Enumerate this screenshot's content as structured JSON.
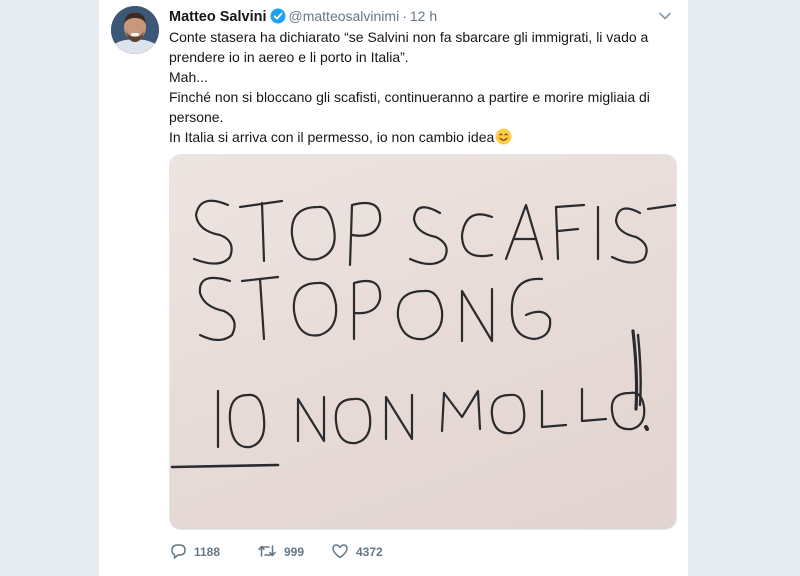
{
  "tweet": {
    "author_name": "Matteo Salvini",
    "handle": "@matteosalvinimi",
    "separator": "·",
    "timestamp": "12 h",
    "lines": [
      "Conte stasera ha dichiarato “se Salvini non fa sbarcare gli immigrati, li vado a prendere io in aereo e li porto in Italia”.",
      "Mah...",
      "Finché non si bloccano gli scafisti, continueranno a partire e morire migliaia di persone.",
      "In Italia si arriva con il permesso, io non cambio idea"
    ],
    "trailing_emoji": "smiling-face-emoji",
    "image_text": [
      "STOP SCAFISTI",
      "STOP ONG",
      "IO NON MOLLO!"
    ]
  },
  "actions": {
    "reply_count": "1188",
    "retweet_count": "999",
    "like_count": "4372"
  },
  "colors": {
    "text": "#14171a",
    "secondary": "#657786",
    "verified": "#1da1f2",
    "background": "#e6ecf0"
  },
  "icons": [
    "verified-badge-icon",
    "chevron-down-icon",
    "reply-icon",
    "retweet-icon",
    "like-icon"
  ]
}
